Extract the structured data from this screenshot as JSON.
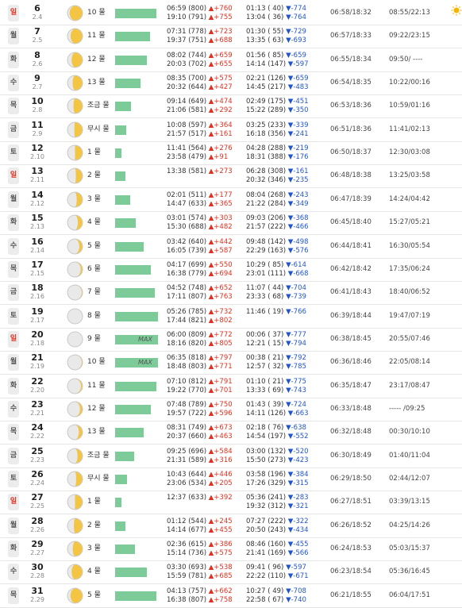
{
  "rows": [
    {
      "dow": "일",
      "sun": true,
      "solar": "6",
      "lunar": "2.4",
      "phase": 0.12,
      "age": "10",
      "bar": 52,
      "max": "",
      "t1": [
        "06:59 (800)",
        "▲+760"
      ],
      "t2": [
        "19:10 (791)",
        "▲+755"
      ],
      "t3": [
        "01:13 ( 40)",
        "▼-774"
      ],
      "t4": [
        "13:04 ( 36)",
        "▼-764"
      ],
      "sunrs": "06:58/18:32",
      "moonrs": "08:55/22:13"
    },
    {
      "dow": "월",
      "sun": false,
      "solar": "7",
      "lunar": "2.5",
      "phase": 0.19,
      "age": "11",
      "bar": 44,
      "max": "",
      "t1": [
        "07:31 (778)",
        "▲+723"
      ],
      "t2": [
        "19:37 (751)",
        "▲+688"
      ],
      "t3": [
        "01:30 ( 55)",
        "▼-729"
      ],
      "t4": [
        "13:35 ( 63)",
        "▼-693"
      ],
      "sunrs": "06:57/18:33",
      "moonrs": "09:22/23:15"
    },
    {
      "dow": "화",
      "sun": false,
      "solar": "8",
      "lunar": "2.6",
      "phase": 0.26,
      "age": "12",
      "bar": 40,
      "max": "",
      "t1": [
        "08:02 (744)",
        "▲+659"
      ],
      "t2": [
        "20:03 (702)",
        "▲+655"
      ],
      "t3": [
        "01:56 ( 85)",
        "▼-659"
      ],
      "t4": [
        "14:14 (147)",
        "▼-597"
      ],
      "sunrs": "06:55/18:34",
      "moonrs": "09:50/ ----"
    },
    {
      "dow": "수",
      "sun": false,
      "solar": "9",
      "lunar": "2.7",
      "phase": 0.33,
      "age": "13",
      "bar": 32,
      "max": "",
      "t1": [
        "08:35 (700)",
        "▲+575"
      ],
      "t2": [
        "20:32 (644)",
        "▲+427"
      ],
      "t3": [
        "02:21 (126)",
        "▼-659"
      ],
      "t4": [
        "14:45 (217)",
        "▼-483"
      ],
      "sunrs": "06:54/18:35",
      "moonrs": "10:22/00:16"
    },
    {
      "dow": "목",
      "sun": false,
      "solar": "10",
      "lunar": "2.8",
      "phase": 0.39,
      "age": "조금",
      "bar": 20,
      "max": "",
      "t1": [
        "09:14 (649)",
        "▲+474"
      ],
      "t2": [
        "21:06 (581)",
        "▲+292"
      ],
      "t3": [
        "02:49 (175)",
        "▼-451"
      ],
      "t4": [
        "15:22 (289)",
        "▼-350"
      ],
      "sunrs": "06:53/18:36",
      "moonrs": "10:59/01:16"
    },
    {
      "dow": "금",
      "sun": false,
      "solar": "11",
      "lunar": "2.9",
      "phase": 0.45,
      "age": "무시",
      "bar": 14,
      "max": "",
      "t1": [
        "10:08 (597)",
        "▲+364"
      ],
      "t2": [
        "21:57 (517)",
        "▲+161"
      ],
      "t3": [
        "03:25 (233)",
        "▼-339"
      ],
      "t4": [
        "16:18 (356)",
        "▼-241"
      ],
      "sunrs": "06:51/18:36",
      "moonrs": "11:41/02:13"
    },
    {
      "dow": "토",
      "sun": false,
      "solar": "12",
      "lunar": "2.10",
      "phase": 0.5,
      "age": "1",
      "bar": 8,
      "max": "",
      "t1": [
        "11:41 (564)",
        "▲+276"
      ],
      "t2": [
        "23:58 (479)",
        "▲+91"
      ],
      "t3": [
        "04:28 (288)",
        "▼-219"
      ],
      "t4": [
        "18:31 (388)",
        "▼-176"
      ],
      "sunrs": "06:50/18:37",
      "moonrs": "12:30/03:08"
    },
    {
      "dow": "일",
      "sun": true,
      "solar": "13",
      "lunar": "2.11",
      "phase": 0.56,
      "age": "2",
      "bar": 13,
      "max": "",
      "t1": [
        "13:38 (581)",
        "▲+273"
      ],
      "t2": null,
      "t3": [
        "06:28 (308)",
        "▼-161"
      ],
      "t4": [
        "20:32 (346)",
        "▼-235"
      ],
      "sunrs": "06:48/18:38",
      "moonrs": "13:25/03:58"
    },
    {
      "dow": "월",
      "sun": false,
      "solar": "14",
      "lunar": "2.12",
      "phase": 0.62,
      "age": "3",
      "bar": 19,
      "max": "",
      "t1": [
        "02:01 (511)",
        "▲+177"
      ],
      "t2": [
        "14:47 (633)",
        "▲+365"
      ],
      "t3": [
        "08:04 (268)",
        "▼-243"
      ],
      "t4": [
        "21:22 (284)",
        "▼-349"
      ],
      "sunrs": "06:47/18:39",
      "moonrs": "14:24/04:42"
    },
    {
      "dow": "화",
      "sun": false,
      "solar": "15",
      "lunar": "2.13",
      "phase": 0.7,
      "age": "4",
      "bar": 26,
      "max": "",
      "t1": [
        "03:01 (574)",
        "▲+303"
      ],
      "t2": [
        "15:30 (688)",
        "▲+482"
      ],
      "t3": [
        "09:03 (206)",
        "▼-368"
      ],
      "t4": [
        "21:57 (222)",
        "▼-466"
      ],
      "sunrs": "06:45/18:40",
      "moonrs": "15:27/05:21"
    },
    {
      "dow": "수",
      "sun": false,
      "solar": "16",
      "lunar": "2.14",
      "phase": 0.8,
      "age": "5",
      "bar": 36,
      "max": "",
      "t1": [
        "03:42 (640)",
        "▲+442"
      ],
      "t2": [
        "16:05 (739)",
        "▲+587"
      ],
      "t3": [
        "09:48 (142)",
        "▼-498"
      ],
      "t4": [
        "22:29 (163)",
        "▼-576"
      ],
      "sunrs": "06:44/18:41",
      "moonrs": "16:30/05:54"
    },
    {
      "dow": "목",
      "sun": false,
      "solar": "17",
      "lunar": "2.15",
      "phase": 0.9,
      "age": "6",
      "bar": 45,
      "max": "",
      "t1": [
        "04:17 (699)",
        "▲+550"
      ],
      "t2": [
        "16:38 (779)",
        "▲+694"
      ],
      "t3": [
        "10:29 ( 85)",
        "▼-614"
      ],
      "t4": [
        "23:01 (111)",
        "▼-668"
      ],
      "sunrs": "06:42/18:42",
      "moonrs": "17:35/06:24"
    },
    {
      "dow": "금",
      "sun": false,
      "solar": "18",
      "lunar": "2.16",
      "phase": 0.97,
      "age": "7",
      "bar": 50,
      "max": "",
      "t1": [
        "04:52 (748)",
        "▲+652"
      ],
      "t2": [
        "17:11 (807)",
        "▲+763"
      ],
      "t3": [
        "11:07 ( 44)",
        "▼-704"
      ],
      "t4": [
        "23:33 ( 68)",
        "▼-739"
      ],
      "sunrs": "06:41/18:43",
      "moonrs": "18:40/06:52"
    },
    {
      "dow": "토",
      "sun": false,
      "solar": "19",
      "lunar": "2.17",
      "phase": 1.0,
      "age": "8",
      "bar": 54,
      "max": "",
      "t1": [
        "05:26 (785)",
        "▲+732"
      ],
      "t2": [
        "17:44 (821)",
        "▲+802"
      ],
      "t3": [
        "11:46 ( 19)",
        "▼-766"
      ],
      "t4": null,
      "sunrs": "06:39/18:44",
      "moonrs": "19:47/07:19"
    },
    {
      "dow": "일",
      "sun": true,
      "solar": "20",
      "lunar": "2.18",
      "phase": 1.0,
      "age": "9",
      "bar": 54,
      "max": "MAX",
      "t1": [
        "06:00 (809)",
        "▲+772"
      ],
      "t2": [
        "18:16 (820)",
        "▲+805"
      ],
      "t3": [
        "00:06 ( 37)",
        "▼-777"
      ],
      "t4": [
        "12:21 ( 15)",
        "▼-794"
      ],
      "sunrs": "06:38/18:45",
      "moonrs": "20:55/07:46"
    },
    {
      "dow": "월",
      "sun": false,
      "solar": "21",
      "lunar": "2.19",
      "phase": 0.97,
      "age": "10",
      "bar": 54,
      "max": "MAX",
      "t1": [
        "06:35 (818)",
        "▲+797"
      ],
      "t2": [
        "18:48 (803)",
        "▲+771"
      ],
      "t3": [
        "00:38 ( 21)",
        "▼-792"
      ],
      "t4": [
        "12:57 ( 32)",
        "▼-785"
      ],
      "sunrs": "06:36/18:46",
      "moonrs": "22:05/08:14"
    },
    {
      "dow": "화",
      "sun": false,
      "solar": "22",
      "lunar": "2.20",
      "phase": 0.92,
      "age": "11",
      "bar": 52,
      "max": "",
      "t1": [
        "07:10 (812)",
        "▲+791"
      ],
      "t2": [
        "19:22 (770)",
        "▲+701"
      ],
      "t3": [
        "01:10 ( 21)",
        "▼-775"
      ],
      "t4": [
        "13:33 ( 69)",
        "▼-743"
      ],
      "sunrs": "06:35/18:47",
      "moonrs": "23:17/08:47"
    },
    {
      "dow": "수",
      "sun": false,
      "solar": "23",
      "lunar": "2.21",
      "phase": 0.85,
      "age": "12",
      "bar": 45,
      "max": "",
      "t1": [
        "07:48 (789)",
        "▲+750"
      ],
      "t2": [
        "19:57 (722)",
        "▲+596"
      ],
      "t3": [
        "01:43 ( 39)",
        "▼-724"
      ],
      "t4": [
        "14:11 (126)",
        "▼-663"
      ],
      "sunrs": "06:33/18:48",
      "moonrs": "----- /09:25"
    },
    {
      "dow": "목",
      "sun": false,
      "solar": "24",
      "lunar": "2.22",
      "phase": 0.77,
      "age": "13",
      "bar": 36,
      "max": "",
      "t1": [
        "08:31 (749)",
        "▲+673"
      ],
      "t2": [
        "20:37 (660)",
        "▲+463"
      ],
      "t3": [
        "02:18 ( 76)",
        "▼-638"
      ],
      "t4": [
        "14:54 (197)",
        "▼-552"
      ],
      "sunrs": "06:32/18:48",
      "moonrs": "00:30/10:10"
    },
    {
      "dow": "금",
      "sun": false,
      "solar": "25",
      "lunar": "2.23",
      "phase": 0.68,
      "age": "조금",
      "bar": 24,
      "max": "",
      "t1": [
        "09:25 (696)",
        "▲+584"
      ],
      "t2": [
        "21:31 (589)",
        "▲+316"
      ],
      "t3": [
        "03:00 (132)",
        "▼-520"
      ],
      "t4": [
        "15:50 (273)",
        "▼-423"
      ],
      "sunrs": "06:30/18:49",
      "moonrs": "01:40/11:04"
    },
    {
      "dow": "토",
      "sun": false,
      "solar": "26",
      "lunar": "2.24",
      "phase": 0.58,
      "age": "무시",
      "bar": 15,
      "max": "",
      "t1": [
        "10:43 (644)",
        "▲+446"
      ],
      "t2": [
        "23:06 (534)",
        "▲+205"
      ],
      "t3": [
        "03:58 (196)",
        "▼-384"
      ],
      "t4": [
        "17:26 (329)",
        "▼-315"
      ],
      "sunrs": "06:29/18:50",
      "moonrs": "02:44/12:07"
    },
    {
      "dow": "일",
      "sun": true,
      "solar": "27",
      "lunar": "2.25",
      "phase": 0.5,
      "age": "1",
      "bar": 8,
      "max": "",
      "t1": [
        "12:37 (633)",
        "▲+392"
      ],
      "t2": null,
      "t3": [
        "05:36 (241)",
        "▼-283"
      ],
      "t4": [
        "19:32 (312)",
        "▼-321"
      ],
      "sunrs": "06:27/18:51",
      "moonrs": "03:39/13:15"
    },
    {
      "dow": "월",
      "sun": false,
      "solar": "28",
      "lunar": "2.26",
      "phase": 0.42,
      "age": "2",
      "bar": 13,
      "max": "",
      "t1": [
        "01:12 (544)",
        "▲+245"
      ],
      "t2": [
        "14:14 (677)",
        "▲+455"
      ],
      "t3": [
        "07:27 (222)",
        "▼-322"
      ],
      "t4": [
        "20:50 (243)",
        "▼-434"
      ],
      "sunrs": "06:26/18:52",
      "moonrs": "04:25/14:26"
    },
    {
      "dow": "화",
      "sun": false,
      "solar": "29",
      "lunar": "2.27",
      "phase": 0.34,
      "age": "3",
      "bar": 25,
      "max": "",
      "t1": [
        "02:36 (615)",
        "▲+386"
      ],
      "t2": [
        "15:14 (736)",
        "▲+575"
      ],
      "t3": [
        "08:46 (160)",
        "▼-455"
      ],
      "t4": [
        "21:41 (169)",
        "▼-566"
      ],
      "sunrs": "06:24/18:53",
      "moonrs": "05:03/15:37"
    },
    {
      "dow": "수",
      "sun": false,
      "solar": "30",
      "lunar": "2.28",
      "phase": 0.26,
      "age": "4",
      "bar": 40,
      "max": "",
      "t1": [
        "03:30 (693)",
        "▲+538"
      ],
      "t2": [
        "15:59 (781)",
        "▲+685"
      ],
      "t3": [
        "09:41 ( 96)",
        "▼-597"
      ],
      "t4": [
        "22:22 (110)",
        "▼-671"
      ],
      "sunrs": "06:23/18:54",
      "moonrs": "05:36/16:45"
    },
    {
      "dow": "목",
      "sun": false,
      "solar": "31",
      "lunar": "2.29",
      "phase": 0.18,
      "age": "5",
      "bar": 52,
      "max": "",
      "t1": [
        "04:13 (757)",
        "▲+662"
      ],
      "t2": [
        "16:38 (807)",
        "▲+758"
      ],
      "t3": [
        "10:27 ( 49)",
        "▼-708"
      ],
      "t4": [
        "22:58 ( 67)",
        "▼-740"
      ],
      "sunrs": "06:21/18:55",
      "moonrs": "06:04/17:51"
    }
  ],
  "colors": {
    "bar": "#7dcb99",
    "rise": "#e0301e",
    "fall": "#2255cc",
    "moon": "#f4c542",
    "sunday": "#e0301e"
  },
  "icons": {
    "corner": "sun-icon"
  }
}
